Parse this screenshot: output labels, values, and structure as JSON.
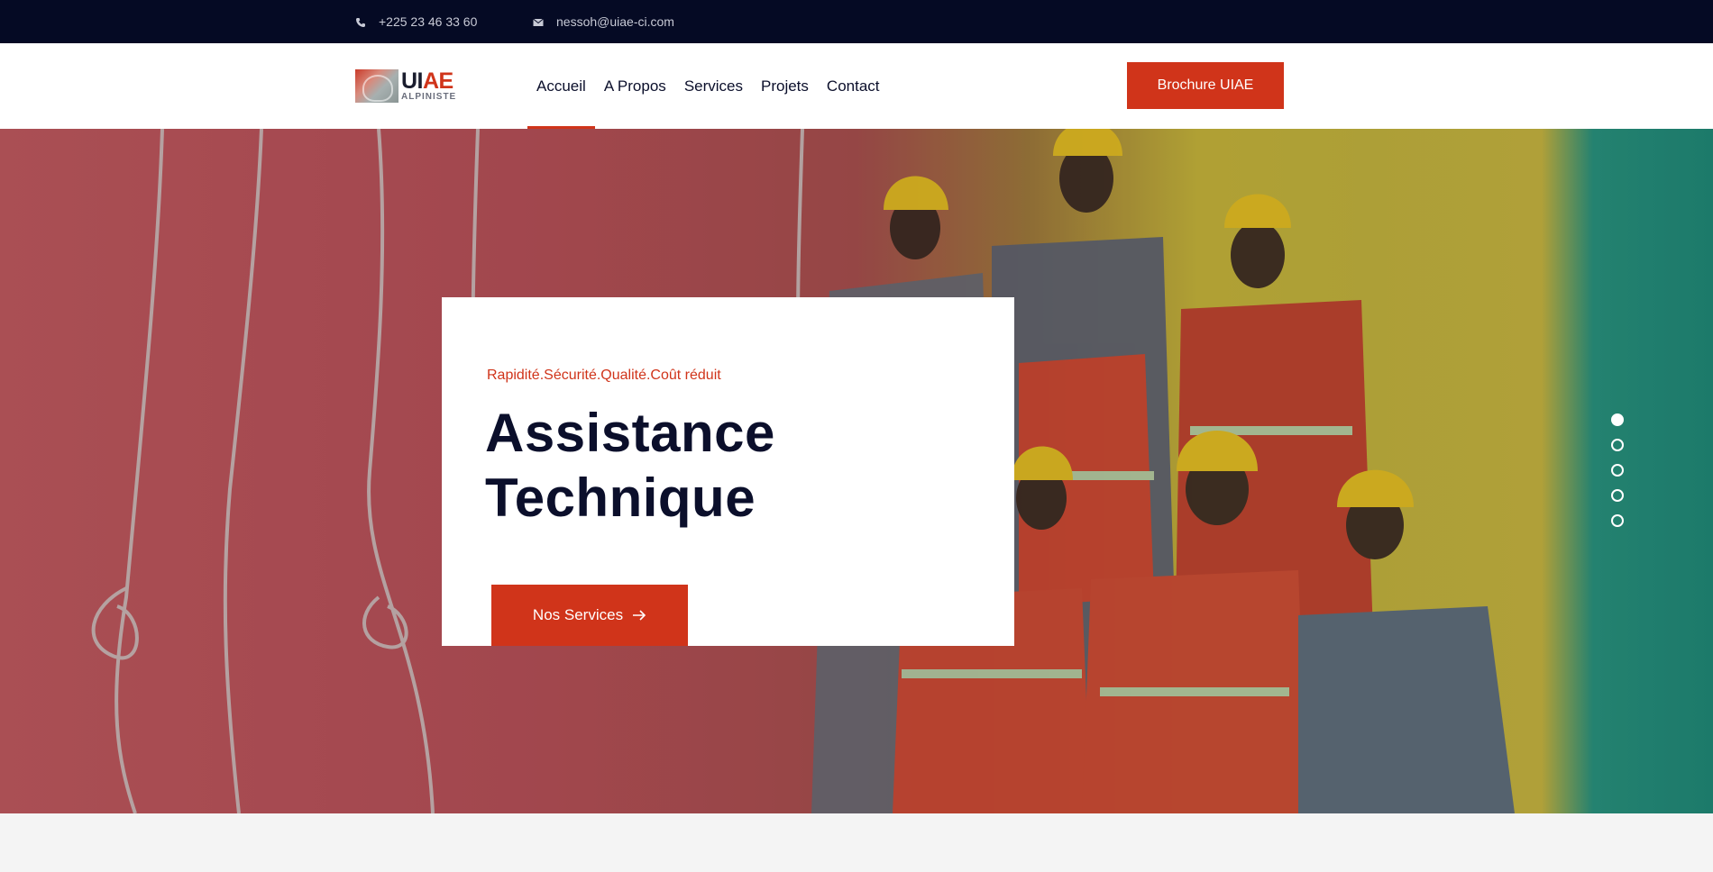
{
  "topbar": {
    "phone": "+225 23 46 33 60",
    "email": "nessoh@uiae-ci.com",
    "phone_icon": "phone-icon",
    "email_icon": "envelope-icon"
  },
  "header": {
    "logo": {
      "main_left": "UI",
      "main_right": "AE",
      "sub": "ALPINISTE"
    },
    "nav": [
      {
        "label": "Accueil",
        "active": true
      },
      {
        "label": "A Propos",
        "active": false
      },
      {
        "label": "Services",
        "active": false
      },
      {
        "label": "Projets",
        "active": false
      },
      {
        "label": "Contact",
        "active": false
      }
    ],
    "cta_label": "Brochure UIAE"
  },
  "hero": {
    "kicker": "Rapidité.Sécurité.Qualité.Coût réduit",
    "title_line1": "Assistance",
    "title_line2": "Technique",
    "button_label": "Nos Services",
    "button_icon": "arrow-right-icon",
    "slides_count": 5,
    "active_slide": 1
  },
  "colors": {
    "accent": "#d0341a",
    "topbar_bg": "#050a24",
    "heading": "#0b0f2b"
  }
}
